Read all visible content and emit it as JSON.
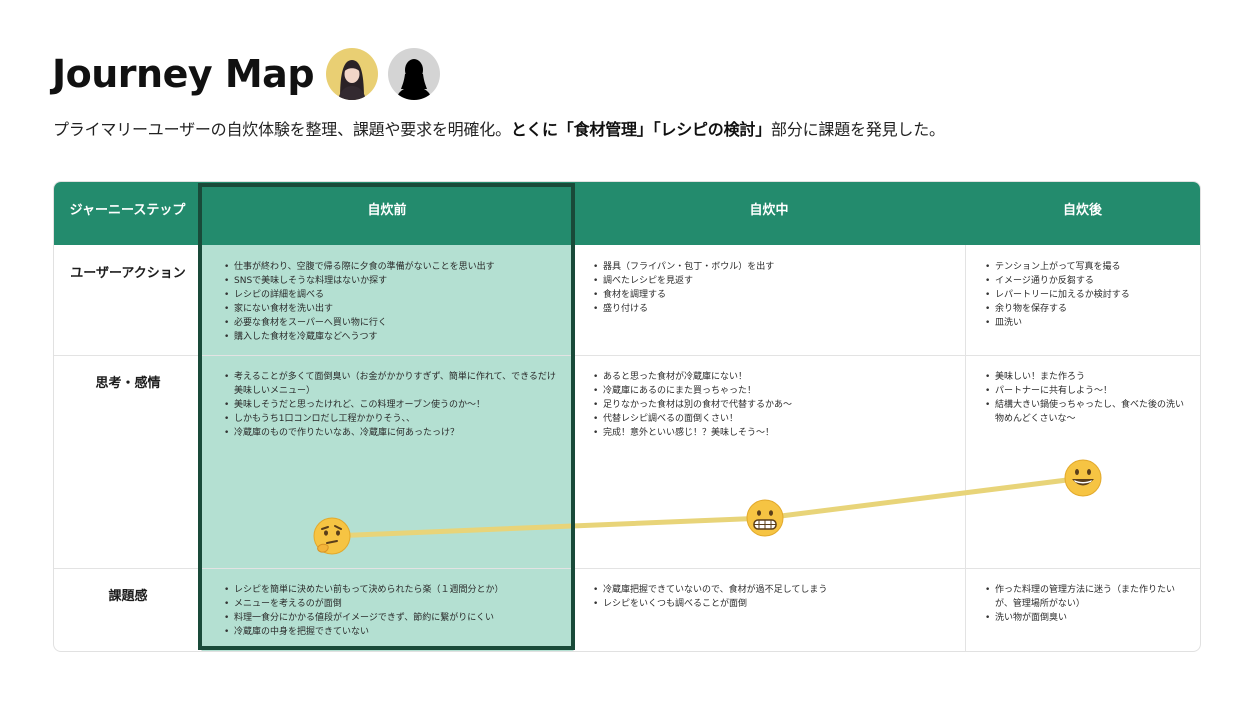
{
  "header": {
    "title": "Journey Map",
    "subtitle_plain": "プライマリーユーザーの自炊体験を整理、課題や要求を明確化。",
    "subtitle_bold": "とくに「食材管理」「レシピの検討」",
    "subtitle_end": "部分に課題を発見した。"
  },
  "colors": {
    "header_green": "#238b6d",
    "highlight_mint": "#b4e0d2",
    "frame_dark": "#194a39",
    "line_yellow": "#e8d479"
  },
  "journey": {
    "step_header": "ジャーニーステップ",
    "phases": [
      "自炊前",
      "自炊中",
      "自炊後"
    ],
    "rows": [
      {
        "label": "ユーザーアクション",
        "cells": [
          [
            "仕事が終わり、空腹で帰る際に夕食の準備がないことを思い出す",
            "SNSで美味しそうな料理はないか探す",
            "レシピの詳細を調べる",
            "家にない食材を洗い出す",
            "必要な食材をスーパーへ買い物に行く",
            "購入した食材を冷蔵庫などへうつす"
          ],
          [
            "器具（フライパン・包丁・ボウル）を出す",
            "調べたレシピを見返す",
            "食材を調理する",
            "盛り付ける"
          ],
          [
            "テンション上がって写真を撮る",
            "イメージ通りか反芻する",
            "レパートリーに加えるか検討する",
            "余り物を保存する",
            "皿洗い"
          ]
        ]
      },
      {
        "label": "思考・感情",
        "cells": [
          [
            "考えることが多くて面倒臭い（お金がかかりすぎず、簡単に作れて、できるだけ美味しいメニュー）",
            "美味しそうだと思ったけれど、この料理オーブン使うのか〜！",
            "しかもうち1口コンロだし工程かかりそう、、",
            "冷蔵庫のもので作りたいなあ、冷蔵庫に何あったっけ？"
          ],
          [
            "あると思った食材が冷蔵庫にない！",
            "冷蔵庫にあるのにまた買っちゃった！",
            "足りなかった食材は別の食材で代替するかあ〜",
            "代替レシピ調べるの面倒くさい！",
            "完成！意外といい感じ！？美味しそう〜！"
          ],
          [
            "美味しい！また作ろう",
            "パートナーに共有しよう〜！",
            "結構大きい鍋使っちゃったし、食べた後の洗い物めんどくさいな〜"
          ]
        ]
      },
      {
        "label": "課題感",
        "cells": [
          [
            "レシピを簡単に決めたい前もって決められたら楽（１週間分とか）",
            "メニューを考えるのが面倒",
            "料理一食分にかかる値段がイメージできず、節約に繋がりにくい",
            "冷蔵庫の中身を把握できていない"
          ],
          [
            "冷蔵庫把握できていないので、食材が過不足してしまう",
            "レシピをいくつも調べることが面倒"
          ],
          [
            "作った料理の管理方法に迷う（また作りたいが、管理場所がない）",
            "洗い物が面倒臭い"
          ]
        ]
      }
    ],
    "emotions": [
      "thinking-face",
      "grimacing-face",
      "grinning-face"
    ],
    "emotion_levels": [
      0.25,
      0.45,
      0.85
    ]
  }
}
